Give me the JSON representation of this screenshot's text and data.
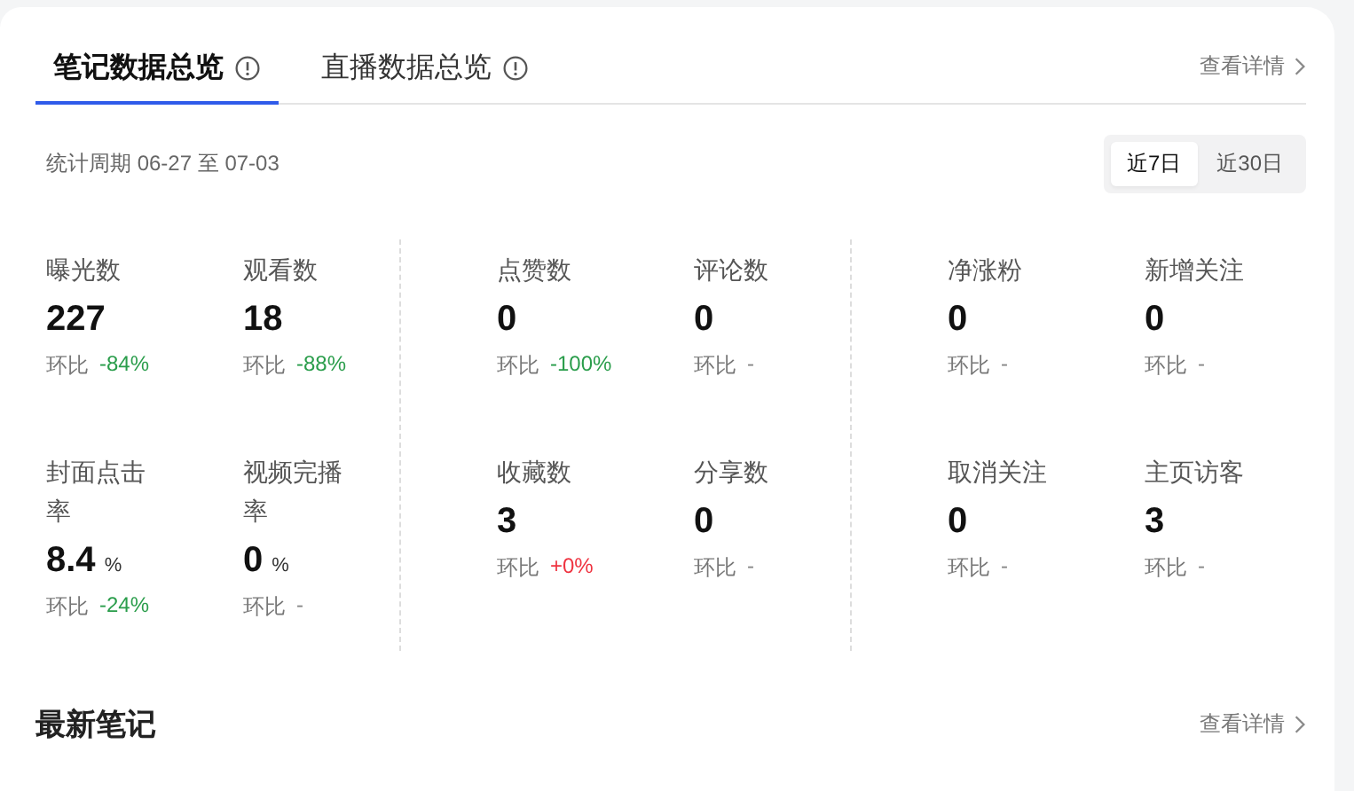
{
  "tabs": [
    {
      "label": "笔记数据总览",
      "selected": true
    },
    {
      "label": "直播数据总览",
      "selected": false
    }
  ],
  "detail_link": "查看详情",
  "period": "统计周期 06-27 至 07-03",
  "range_options": [
    {
      "label": "近7日",
      "selected": true
    },
    {
      "label": "近30日",
      "selected": false
    }
  ],
  "metric_groups": [
    {
      "metrics": [
        {
          "label": "曝光数",
          "value": "227",
          "change_label": "环比",
          "change": "-84%",
          "color": "#2a9d4b"
        },
        {
          "label": "观看数",
          "value": "18",
          "change_label": "环比",
          "change": "-88%",
          "color": "#2a9d4b"
        },
        {
          "label": "封面点击率",
          "value": "8.4",
          "unit": "%",
          "change_label": "环比",
          "change": "-24%",
          "color": "#2a9d4b"
        },
        {
          "label": "视频完播率",
          "value": "0",
          "unit": "%",
          "change_label": "环比",
          "change": "-",
          "color": "#888888"
        }
      ]
    },
    {
      "metrics": [
        {
          "label": "点赞数",
          "value": "0",
          "change_label": "环比",
          "change": "-100%",
          "color": "#2a9d4b"
        },
        {
          "label": "评论数",
          "value": "0",
          "change_label": "环比",
          "change": "-",
          "color": "#888888"
        },
        {
          "label": "收藏数",
          "value": "3",
          "change_label": "环比",
          "change": "+0%",
          "color": "#ef3340"
        },
        {
          "label": "分享数",
          "value": "0",
          "change_label": "环比",
          "change": "-",
          "color": "#888888"
        }
      ]
    },
    {
      "metrics": [
        {
          "label": "净涨粉",
          "value": "0",
          "change_label": "环比",
          "change": "-",
          "color": "#888888"
        },
        {
          "label": "新增关注",
          "value": "0",
          "change_label": "环比",
          "change": "-",
          "color": "#888888"
        },
        {
          "label": "取消关注",
          "value": "0",
          "change_label": "环比",
          "change": "-",
          "color": "#888888"
        },
        {
          "label": "主页访客",
          "value": "3",
          "change_label": "环比",
          "change": "-",
          "color": "#888888"
        }
      ]
    }
  ],
  "latest_notes": {
    "title": "最新笔记",
    "detail_link": "查看详情"
  }
}
